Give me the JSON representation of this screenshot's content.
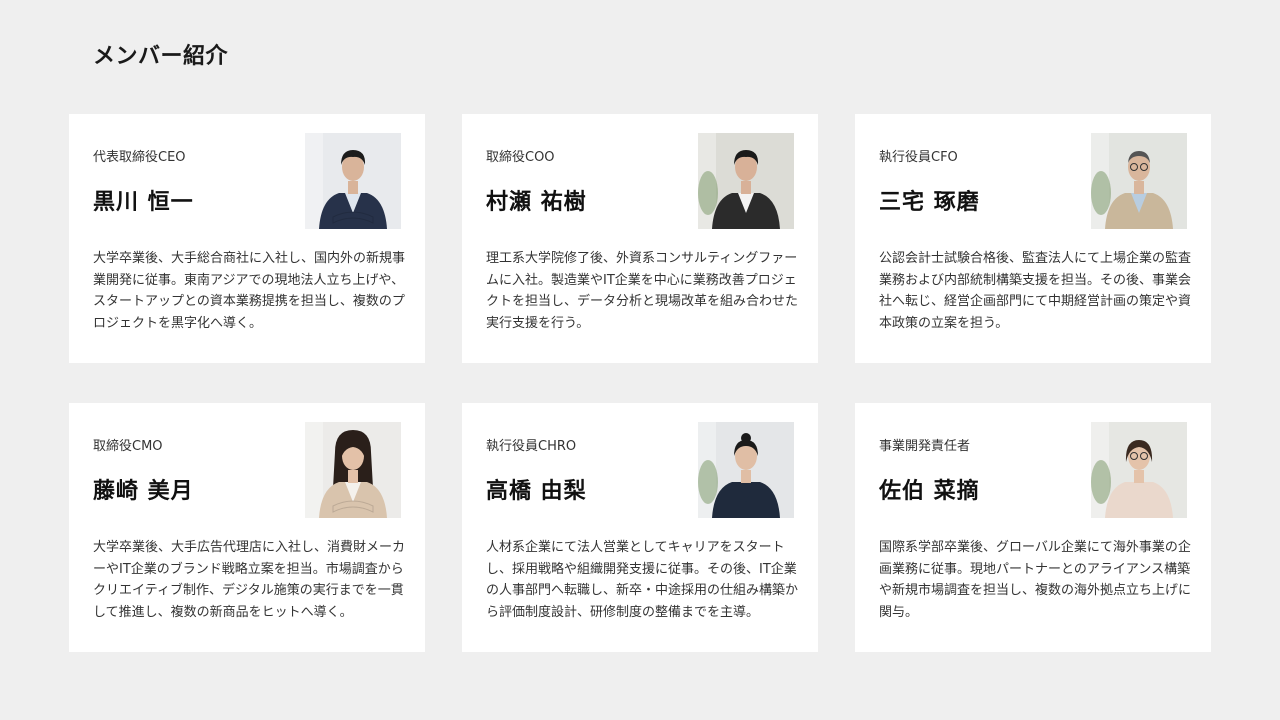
{
  "page": {
    "title": "メンバー紹介"
  },
  "members": [
    {
      "role": "代表取締役CEO",
      "name": "黒川 恒一",
      "bio": "大学卒業後、大手総合商社に入社し、国内外の新規事業開発に従事。東南アジアでの現地法人立ち上げや、スタートアップとの資本業務提携を担当し、複数のプロジェクトを黒字化へ導く。",
      "photo": {
        "bg": "#e8eaed",
        "suit": "#27324a",
        "shirt": "#dfe6ef",
        "hair": "#1c1c1c",
        "skin": "#d9b49a",
        "style": "suit-arms-crossed"
      }
    },
    {
      "role": "取締役COO",
      "name": "村瀬 祐樹",
      "bio": "理工系大学院修了後、外資系コンサルティングファームに入社。製造業やIT企業を中心に業務改善プロジェクトを担当し、データ分析と現場改革を組み合わせた実行支援を行う。",
      "photo": {
        "bg": "#dcdcd6",
        "suit": "#2b2b2b",
        "shirt": "#f3f3f3",
        "hair": "#1a1a1a",
        "skin": "#d8b198",
        "style": "jacket-tee"
      }
    },
    {
      "role": "執行役員CFO",
      "name": "三宅 琢磨",
      "bio": "公認会計士試験合格後、監査法人にて上場企業の監査業務および内部統制構築支援を担当。その後、事業会社へ転じ、経営企画部門にて中期経営計画の策定や資本政策の立案を担う。",
      "photo": {
        "bg": "#e2e4e0",
        "suit": "#c9b79b",
        "shirt": "#b8cde0",
        "hair": "#555555",
        "skin": "#d9b69c",
        "style": "casual-glasses"
      }
    },
    {
      "role": "取締役CMO",
      "name": "藤崎 美月",
      "bio": "大学卒業後、大手広告代理店に入社し、消費財メーカーやIT企業のブランド戦略立案を担当。市場調査からクリエイティブ制作、デジタル施策の実行までを一貫して推進し、複数の新商品をヒットへ導く。",
      "photo": {
        "bg": "#ecebe9",
        "suit": "#d9c4ad",
        "shirt": "#f4f1ec",
        "hair": "#2a1f1a",
        "skin": "#e3c1a8",
        "style": "female-long"
      }
    },
    {
      "role": "執行役員CHRO",
      "name": "高橋 由梨",
      "bio": "人材系企業にて法人営業としてキャリアをスタートし、採用戦略や組織開発支援に従事。その後、IT企業の人事部門へ転職し、新卒・中途採用の仕組み構築から評価制度設計、研修制度の整備までを主導。",
      "photo": {
        "bg": "#e4e6e8",
        "suit": "#1f2a3c",
        "shirt": "#1f2a3c",
        "hair": "#1a1a1a",
        "skin": "#e0bea5",
        "style": "female-bun"
      }
    },
    {
      "role": "事業開発責任者",
      "name": "佐伯 菜摘",
      "bio": "国際系学部卒業後、グローバル企業にて海外事業の企画業務に従事。現地パートナーとのアライアンス構築や新規市場調査を担当し、複数の海外拠点立ち上げに関与。",
      "photo": {
        "bg": "#e6e7e3",
        "suit": "#ead8cc",
        "shirt": "#ead8cc",
        "hair": "#3a2a20",
        "skin": "#e4c3aa",
        "style": "female-glasses"
      }
    }
  ]
}
